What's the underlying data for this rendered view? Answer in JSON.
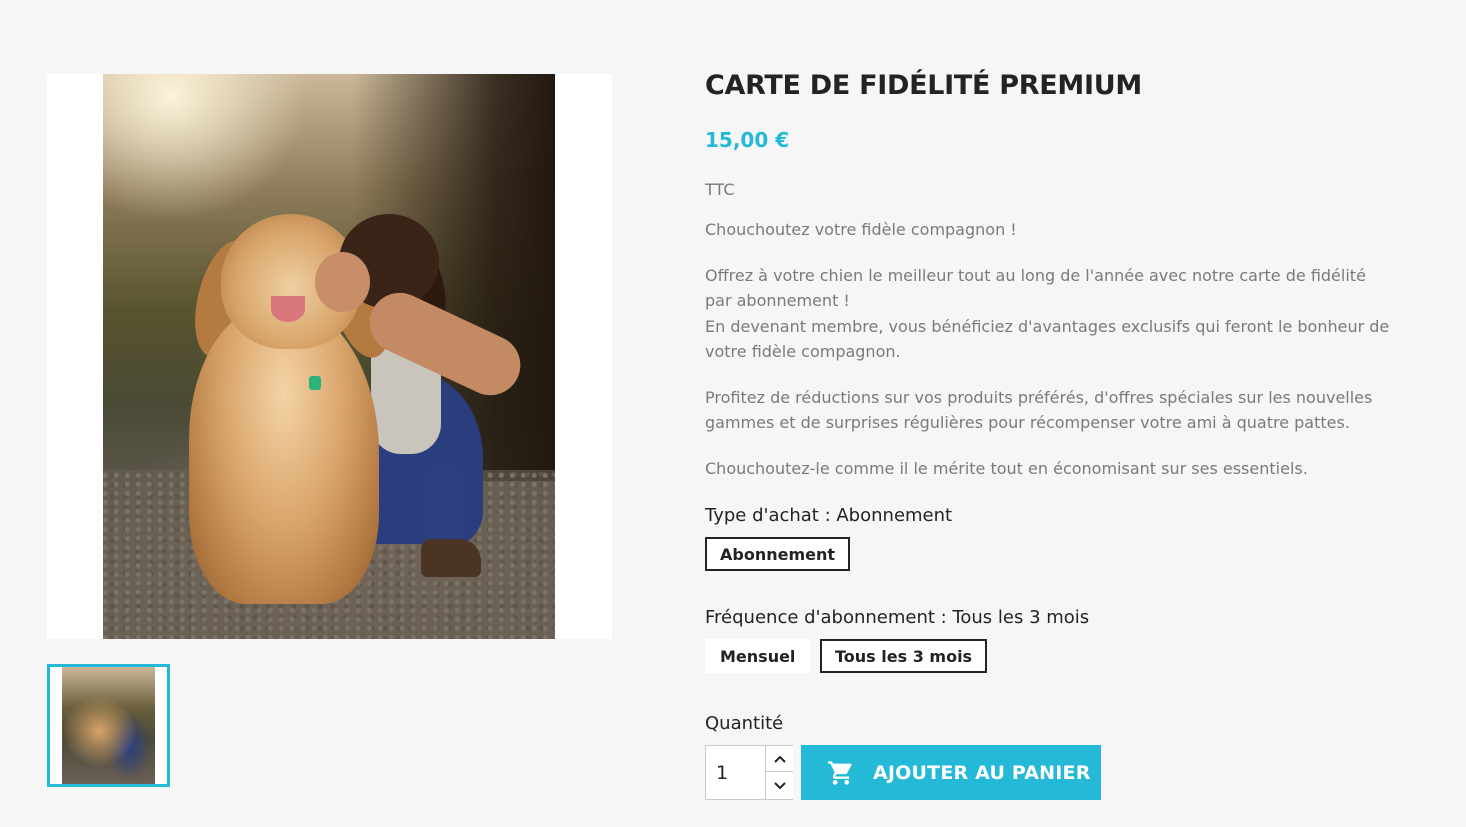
{
  "product": {
    "title": "CARTE DE FIDÉLITÉ PREMIUM",
    "price": "15,00 €",
    "tax_label": "TTC",
    "description": {
      "intro": "Chouchoutez votre fidèle compagnon !",
      "p1_line1": "Offrez à votre chien le meilleur tout au long de l'année avec notre carte de fidélité par abonnement !",
      "p1_line2": "En devenant membre, vous bénéficiez d'avantages exclusifs qui feront le bonheur de votre fidèle compagnon.",
      "p2": "Profitez de réductions sur vos produits préférés, d'offres spéciales sur les nouvelles gammes et de surprises régulières pour récompenser votre ami à quatre pattes.",
      "p3": "Chouchoutez-le comme il le mérite tout en économisant sur ses essentiels."
    }
  },
  "variants": {
    "purchase_type": {
      "label": "Type d'achat : Abonnement",
      "options": [
        "Abonnement"
      ],
      "selected": "Abonnement"
    },
    "frequency": {
      "label": "Fréquence d'abonnement : Tous les 3 mois",
      "options": [
        "Mensuel",
        "Tous les 3 mois"
      ],
      "selected": "Tous les 3 mois"
    }
  },
  "quantity": {
    "label": "Quantité",
    "value": "1"
  },
  "cart": {
    "button_label": "AJOUTER AU PANIER",
    "icon": "shopping-cart-icon"
  },
  "colors": {
    "accent": "#24b9d7",
    "text_dark": "#232323",
    "text_muted": "#7a7a7a",
    "background": "#f6f6f6"
  }
}
